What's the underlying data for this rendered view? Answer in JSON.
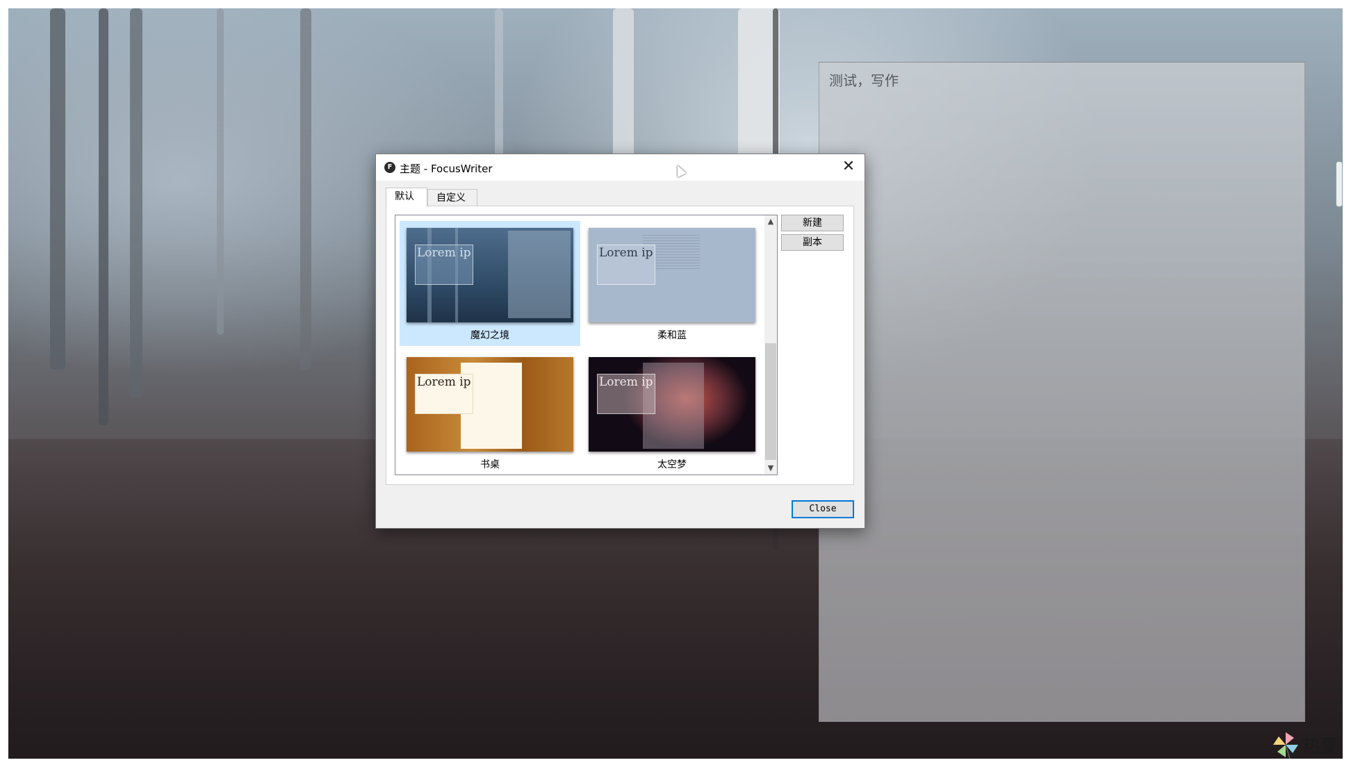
{
  "document": {
    "text": "测试，写作"
  },
  "dialog": {
    "title": "主题 - FocusWriter",
    "app_icon": "F",
    "close_glyph": "✕",
    "tabs": [
      {
        "label": "默认",
        "active": true
      },
      {
        "label": "自定义",
        "active": false
      }
    ],
    "themes": [
      {
        "name": "魔幻之境",
        "preview_text": "Lorem ip sit amet p",
        "selected": true
      },
      {
        "name": "柔和蓝",
        "preview_text": "Lorem ip sit amet p",
        "selected": false
      },
      {
        "name": "书桌",
        "preview_text": "Lorem ip sit amet p",
        "selected": false
      },
      {
        "name": "太空梦",
        "preview_text": "Lorem ip sit amet p",
        "selected": false
      }
    ],
    "buttons": {
      "new": "新建",
      "duplicate": "副本",
      "close": "Close"
    }
  },
  "watermark": {
    "text": "热夏"
  },
  "colors": {
    "selection": "#cce8ff",
    "accent": "#0078d7",
    "soft_blue_bg": "#a8b8cc"
  }
}
